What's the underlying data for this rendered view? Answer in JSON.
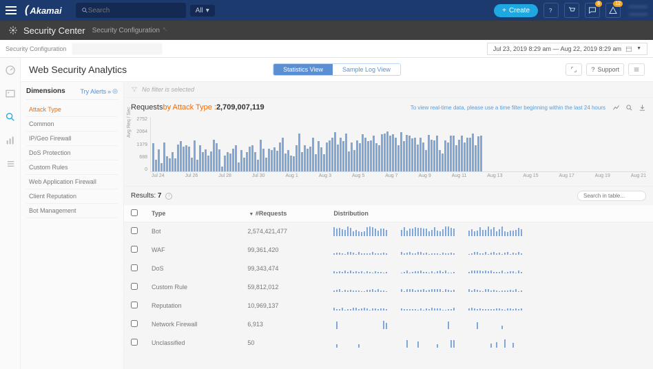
{
  "top": {
    "brand": "Akamai",
    "search_placeholder": "Search",
    "search_filter": "All",
    "create": "Create",
    "badge_msg": "8",
    "badge_alert": "12",
    "user_line1": "———",
    "user_line2": "———"
  },
  "subheader": {
    "title": "Security Center",
    "config": "Security Configuration"
  },
  "breadcrumb": {
    "label": "Security Configuration",
    "date_range": "Jul 23, 2019  8:29 am  —  Aug 22, 2019  8:29 am"
  },
  "page": {
    "title": "Web Security Analytics",
    "view_stats": "Statistics View",
    "view_log": "Sample Log View",
    "support": "Support"
  },
  "dimensions": {
    "header": "Dimensions",
    "try_alerts": "Try Alerts",
    "items": [
      {
        "label": "Attack Type",
        "active": true
      },
      {
        "label": "Common"
      },
      {
        "label": "IP/Geo Firewall"
      },
      {
        "label": "DoS Protection"
      },
      {
        "label": "Custom Rules"
      },
      {
        "label": "Web Application Firewall"
      },
      {
        "label": "Client Reputation"
      },
      {
        "label": "Bot Management"
      }
    ]
  },
  "filter": {
    "text": "No filter is selected"
  },
  "chart_header": {
    "label": "Requests",
    "by": " by Attack Type : ",
    "total": "2,709,007,119",
    "note": "To view real-time data, please use a time filter beginning within the last 24 hours"
  },
  "chart_data": {
    "type": "bar",
    "ylabel": "Avg Req / Sec",
    "ylim": [
      0,
      2752
    ],
    "yticks": [
      "2752",
      "2064",
      "1379",
      "688",
      "0"
    ],
    "x_labels": [
      "Jul 24",
      "Jul 26",
      "Jul 28",
      "Jul 30",
      "Aug 1",
      "Aug 3",
      "Aug 5",
      "Aug 7",
      "Aug 9",
      "Aug 11",
      "Aug 13",
      "Aug 15",
      "Aug 17",
      "Aug 19",
      "Aug 21"
    ],
    "values": [
      1400,
      600,
      1100,
      400,
      1450,
      750,
      650,
      950,
      650,
      1350,
      1500,
      1250,
      1300,
      1250,
      700,
      1550,
      600,
      1300,
      950,
      1100,
      800,
      1000,
      1600,
      1400,
      1100,
      250,
      800,
      950,
      880,
      1150,
      1300,
      450,
      1050,
      700,
      980,
      1250,
      1300,
      950,
      600,
      1600,
      1150,
      700,
      1150,
      1050,
      1200,
      1020,
      1450,
      1700,
      900,
      1050,
      800,
      760,
      1300,
      1900,
      980,
      1300,
      1150,
      1250,
      1700,
      850,
      1500,
      1200,
      860,
      1450,
      1550,
      1700,
      1950,
      1350,
      1700,
      1500,
      1900,
      1000,
      1450,
      1050,
      1550,
      1400,
      1850,
      1700,
      1500,
      1550,
      1800,
      1400,
      1300,
      1850,
      1900,
      2000,
      1800,
      1860,
      1700,
      1300,
      1950,
      1500,
      1820,
      1780,
      1650,
      1700,
      1350,
      1700,
      1460,
      1050,
      1820,
      1600,
      1550,
      1800,
      1050,
      900,
      1550,
      1450,
      1780,
      1800,
      1300,
      1600,
      1800,
      1450,
      1700,
      1700,
      1900,
      1300,
      1750,
      1800
    ]
  },
  "results": {
    "label": "Results:",
    "count": "7",
    "search_placeholder": "Search in table...",
    "cols": {
      "type": "Type",
      "requests": "#Requests",
      "dist": "Distribution"
    },
    "rows": [
      {
        "type": "Bot",
        "requests": "2,574,421,477"
      },
      {
        "type": "WAF",
        "requests": "99,361,420"
      },
      {
        "type": "DoS",
        "requests": "99,343,474"
      },
      {
        "type": "Custom Rule",
        "requests": "59,812,012"
      },
      {
        "type": "Reputation",
        "requests": "10,969,137"
      },
      {
        "type": "Network Firewall",
        "requests": "6,913"
      },
      {
        "type": "Unclassified",
        "requests": "50"
      }
    ]
  }
}
